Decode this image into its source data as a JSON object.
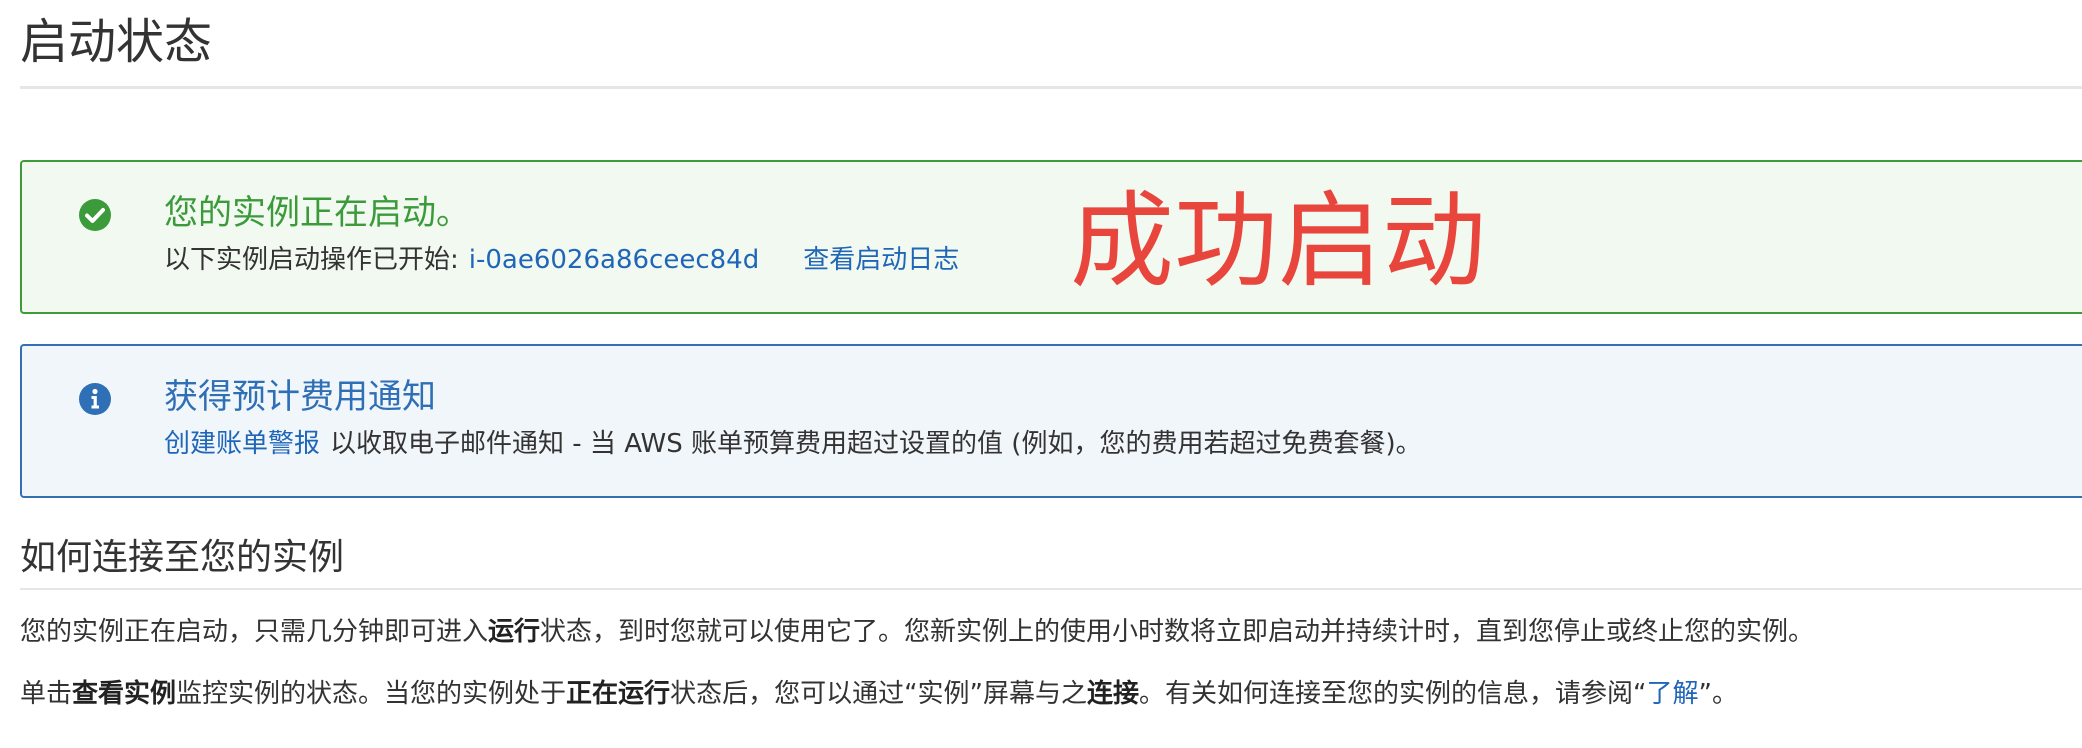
{
  "page": {
    "title": "启动状态"
  },
  "success_alert": {
    "title": "您的实例正在启动。",
    "prefix": "以下实例启动操作已开始:",
    "instance_id": "i-0ae6026a86ceec84d",
    "view_log_link": "查看启动日志",
    "status": "success",
    "icon": "check-circle-icon"
  },
  "annotation": {
    "text": "成功启动",
    "color": "#e8453c"
  },
  "info_alert": {
    "title": "获得预计费用通知",
    "create_alarm_link": "创建账单警报",
    "body": "以收取电子邮件通知 - 当 AWS 账单预算费用超过设置的值 (例如，您的费用若超过免费套餐)。",
    "icon": "info-circle-icon"
  },
  "connect_section": {
    "title": "如何连接至您的实例",
    "para1": {
      "part1": "您的实例正在启动，只需几分钟即可进入",
      "bold1": "运行",
      "part2": "状态，到时您就可以使用它了。您新实例上的使用小时数将立即启动并持续计时，直到您停止或终止您的实例。"
    },
    "para2": {
      "part1": "单击",
      "bold1": "查看实例",
      "part2": "监控实例的状态。当您的实例处于",
      "bold2": "正在运行",
      "part3": "状态后，您可以通过“实例”屏幕与之",
      "bold3": "连接",
      "part4": "。有关如何连接至您的实例的信息，请参阅“",
      "learn_link": "了解",
      "part5": "”。"
    }
  },
  "colors": {
    "success_border": "#3d9b3a",
    "success_bg": "#f2f9f1",
    "info_border": "#3470b1",
    "info_bg": "#f1f6fb",
    "link": "#1f66b8"
  }
}
